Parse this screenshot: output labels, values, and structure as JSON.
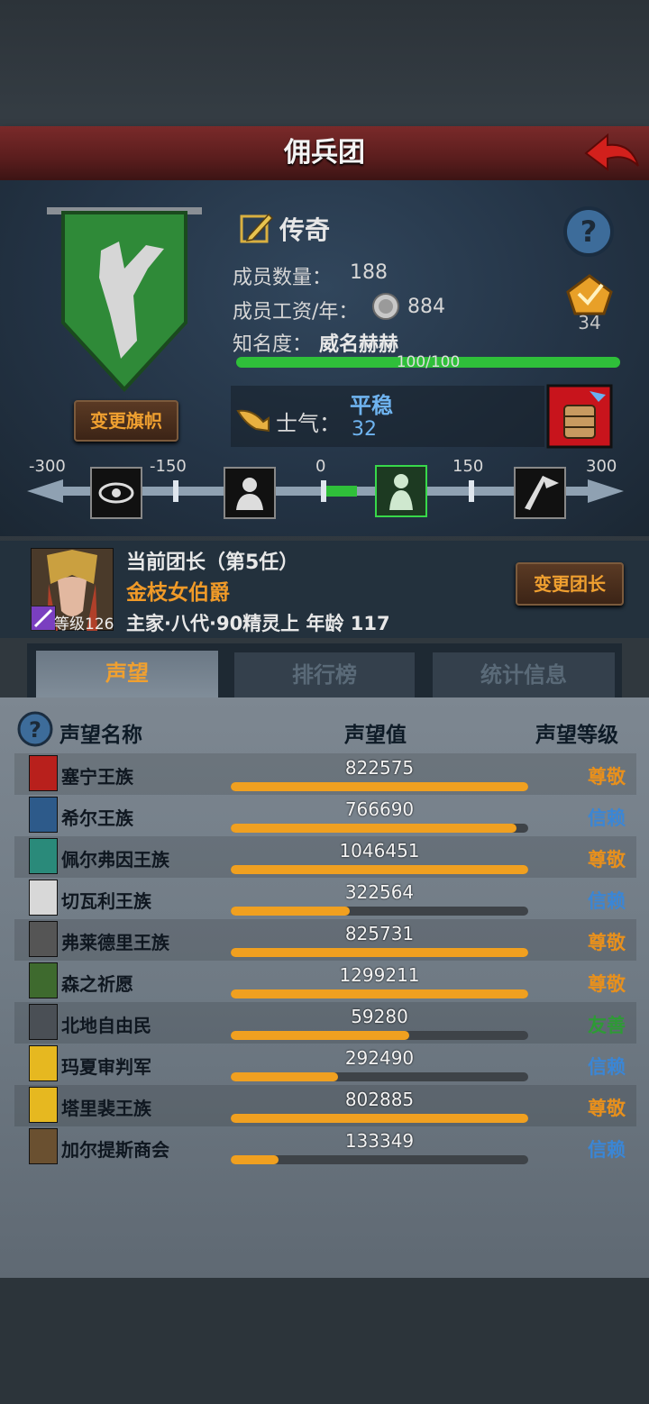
{
  "header": {
    "title": "佣兵团"
  },
  "top": {
    "rank": "传奇",
    "members_label": "成员数量：",
    "members_value": "188",
    "salary_label": "成员工资/年：",
    "salary_value": "884",
    "fame_label": "知名度：",
    "fame_state": "威名赫赫",
    "fame_progress": "100/100",
    "badge_value": "34",
    "change_banner": "变更旗帜",
    "morale_label": "士气：",
    "morale_state": "平稳",
    "morale_value": "32",
    "scale_ticks": [
      "-300",
      "-150",
      "0",
      "150",
      "300"
    ]
  },
  "leader": {
    "title": "当前团长（第5任）",
    "name": "金枝女伯爵",
    "level_label": "等级126",
    "info": "主家·八代·90精灵上 年龄 117",
    "change_leader": "变更团长"
  },
  "tabs": [
    "声望",
    "排行榜",
    "统计信息"
  ],
  "table": {
    "headers": {
      "name": "声望名称",
      "value": "声望值",
      "level": "声望等级"
    },
    "rows": [
      {
        "name": "塞宁王族",
        "value": "822575",
        "level": "尊敬",
        "fill": 1.0
      },
      {
        "name": "希尔王族",
        "value": "766690",
        "level": "信赖",
        "fill": 0.96
      },
      {
        "name": "佩尔弗因王族",
        "value": "1046451",
        "level": "尊敬",
        "fill": 1.0
      },
      {
        "name": "切瓦利王族",
        "value": "322564",
        "level": "信赖",
        "fill": 0.4
      },
      {
        "name": "弗莱德里王族",
        "value": "825731",
        "level": "尊敬",
        "fill": 1.0
      },
      {
        "name": "森之祈愿",
        "value": "1299211",
        "level": "尊敬",
        "fill": 1.0
      },
      {
        "name": "北地自由民",
        "value": "59280",
        "level": "友善",
        "fill": 0.6
      },
      {
        "name": "玛夏审判军",
        "value": "292490",
        "level": "信赖",
        "fill": 0.36
      },
      {
        "name": "塔里裴王族",
        "value": "802885",
        "level": "尊敬",
        "fill": 1.0
      },
      {
        "name": "加尔提斯商会",
        "value": "133349",
        "level": "信赖",
        "fill": 0.16
      }
    ]
  },
  "colors": {
    "respect": "#e8901c",
    "trust": "#3a86d6",
    "friendly": "#2e9a36"
  }
}
